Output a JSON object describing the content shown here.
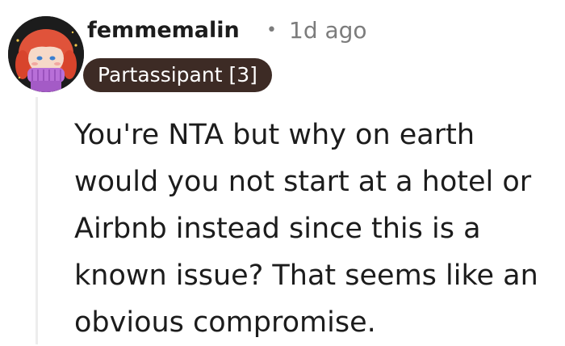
{
  "comment": {
    "author": "femmemalin",
    "separator": "•",
    "timestamp": "1d ago",
    "flair": "Partassipant [3]",
    "body": "You're NTA but why on earth would you not start at a hotel or Airbnb instead since this is a known issue? That seems like an obvious compromise."
  },
  "colors": {
    "flair_bg": "#3d2b25",
    "avatar_bg": "#1c1c1c",
    "text": "#1c1c1c",
    "muted": "#7c7c7c"
  },
  "icons": {
    "avatar": "snoo-avatar-red-hair-purple-scarf"
  }
}
